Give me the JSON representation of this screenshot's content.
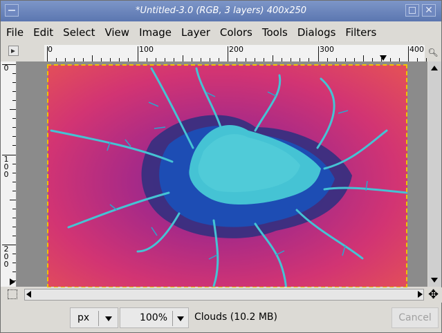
{
  "window": {
    "title": "*Untitled-3.0 (RGB, 3 layers) 400x250"
  },
  "menu": [
    "File",
    "Edit",
    "Select",
    "View",
    "Image",
    "Layer",
    "Colors",
    "Tools",
    "Dialogs",
    "Filters"
  ],
  "rulers": {
    "horizontal_labels": [
      "0",
      "100",
      "200",
      "300",
      "400"
    ],
    "vertical_labels": [
      "0",
      "1\n0\n0",
      "2\n0\n0"
    ]
  },
  "canvas": {
    "layer_colors": {
      "outer": "#e2346a",
      "mid": "#a82a87",
      "blue": "#1d4db4",
      "cyan": "#45c3d4"
    }
  },
  "statusbar": {
    "unit": "px",
    "zoom": "100%",
    "status": "Clouds (10.2 MB)",
    "cancel": "Cancel"
  },
  "icons": {
    "window_menu": "window-menu-icon",
    "maximize": "maximize-icon",
    "close": "close-icon",
    "quick_mask": "quick-mask-icon",
    "zoom": "zoom-icon",
    "navigate": "navigate-icon"
  }
}
